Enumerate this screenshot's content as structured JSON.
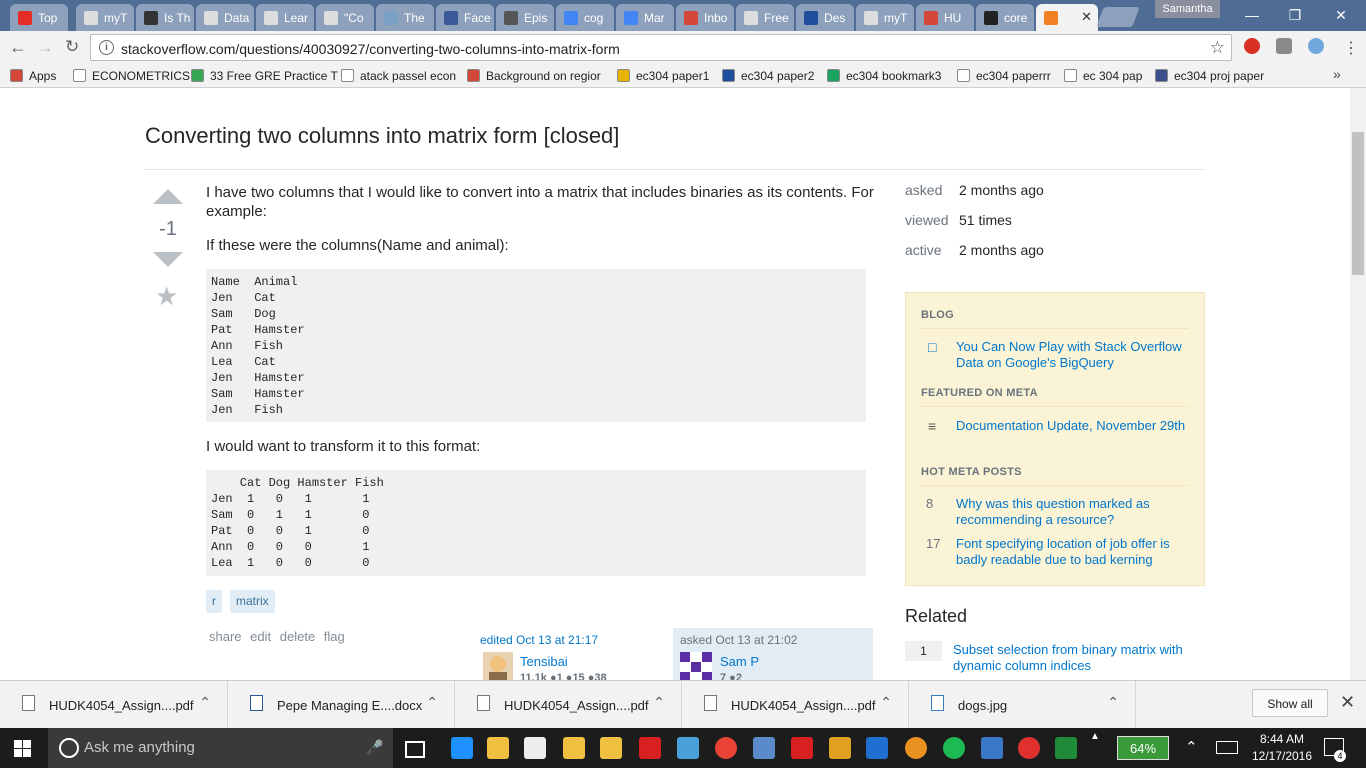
{
  "browser": {
    "tabs": [
      {
        "label": "Top",
        "icon": "youtube-icon",
        "color": "#e52d27"
      },
      {
        "label": "myT",
        "icon": "page-icon",
        "color": "#dddddd"
      },
      {
        "label": "Is Th",
        "icon": "sa-icon",
        "color": "#333333"
      },
      {
        "label": "Data",
        "icon": "page-icon",
        "color": "#dddddd"
      },
      {
        "label": "Lear",
        "icon": "page-icon",
        "color": "#dddddd"
      },
      {
        "label": "\"Co",
        "icon": "page-icon",
        "color": "#dddddd"
      },
      {
        "label": "The",
        "icon": "4c-icon",
        "color": "#7aa0c4"
      },
      {
        "label": "Face",
        "icon": "facebook-icon",
        "color": "#3b5998"
      },
      {
        "label": "Epis",
        "icon": "film-icon",
        "color": "#555555"
      },
      {
        "label": "cog",
        "icon": "docs-icon",
        "color": "#4285f4"
      },
      {
        "label": "Mar",
        "icon": "docs-icon",
        "color": "#4285f4"
      },
      {
        "label": "Inbo",
        "icon": "gmail-icon",
        "color": "#d44638"
      },
      {
        "label": "Free",
        "icon": "page-icon",
        "color": "#dddddd"
      },
      {
        "label": "Des",
        "icon": "e-icon",
        "color": "#1f4e9c"
      },
      {
        "label": "myT",
        "icon": "page-icon",
        "color": "#dddddd"
      },
      {
        "label": "HU",
        "icon": "gmail-icon",
        "color": "#d44638"
      },
      {
        "label": "core",
        "icon": "github-icon",
        "color": "#222222"
      },
      {
        "label": "",
        "icon": "stackoverflow-icon",
        "color": "#f48024",
        "active": true
      }
    ],
    "profile": "Samantha",
    "url": "stackoverflow.com/questions/40030927/converting-two-columns-into-matrix-form",
    "bookmarks": [
      {
        "label": "Apps",
        "color": "#d44638"
      },
      {
        "label": "ECONOMETRICS",
        "color": "#ffffff"
      },
      {
        "label": "33 Free GRE Practice T",
        "color": "#34a853"
      },
      {
        "label": "atack passel econ",
        "color": "#ffffff"
      },
      {
        "label": "Background on regior",
        "color": "#d44638"
      },
      {
        "label": "ec304 paper1",
        "color": "#e8b400"
      },
      {
        "label": "ec304 paper2",
        "color": "#1f4e9c"
      },
      {
        "label": "ec304 bookmark3",
        "color": "#1aa260"
      },
      {
        "label": "ec304 paperrr",
        "color": "#ffffff"
      },
      {
        "label": "ec 304 pap",
        "color": "#ffffff"
      },
      {
        "label": "ec304 proj paper",
        "color": "#3b4f8a"
      }
    ],
    "more_bookmarks": "»"
  },
  "question": {
    "title": "Converting two columns into matrix form [closed]",
    "score": "-1",
    "para1": "I have two columns that I would like to convert into a matrix that includes binaries as its contents. For example:",
    "para2": "If these were the columns(Name and animal):",
    "code1": "Name  Animal\nJen   Cat\nSam   Dog\nPat   Hamster\nAnn   Fish\nLea   Cat\nJen   Hamster\nSam   Hamster\nJen   Fish",
    "para3": "I would want to transform it to this format:",
    "code2": "    Cat Dog Hamster Fish\nJen  1   0   1       1\nSam  0   1   1       0\nPat  0   0   1       0\nAnn  0   0   0       1\nLea  1   0   0       0",
    "tags": [
      "r",
      "matrix"
    ],
    "menu": [
      "share",
      "edit",
      "delete",
      "flag"
    ],
    "edited": {
      "action": "edited Oct 13 at 21:17",
      "user": "Tensibai",
      "rep": "11.1k ●1 ●15 ●38"
    },
    "asked": {
      "action": "asked Oct 13 at 21:02",
      "user": "Sam P",
      "rep": "7 ●2"
    }
  },
  "sidebar": {
    "stats": [
      {
        "label": "asked",
        "value": "2 months ago"
      },
      {
        "label": "viewed",
        "value": "51 times"
      },
      {
        "label": "active",
        "value": "2 months ago"
      }
    ],
    "blog_heading": "BLOG",
    "blog_link": "You Can Now Play with Stack Overflow Data on Google's BigQuery",
    "featured_heading": "FEATURED ON META",
    "featured_link": "Documentation Update, November 29th",
    "hot_heading": "HOT META POSTS",
    "hot_posts": [
      {
        "count": "8",
        "title": "Why was this question marked as recommending a resource?"
      },
      {
        "count": "17",
        "title": "Font specifying location of job offer is badly readable due to bad kerning"
      }
    ],
    "related_heading": "Related",
    "related": [
      {
        "count": "1",
        "title": "Subset selection from binary matrix with dynamic column indices"
      }
    ]
  },
  "downloads": {
    "items": [
      "HUDK4054_Assign....pdf",
      "Pepe Managing E....docx",
      "HUDK4054_Assign....pdf",
      "HUDK4054_Assign....pdf",
      "dogs.jpg"
    ],
    "show_all": "Show all"
  },
  "taskbar": {
    "search_placeholder": "Ask me anything",
    "battery": "64%",
    "time": "8:44 AM",
    "date": "12/17/2016",
    "notifications": "4"
  }
}
